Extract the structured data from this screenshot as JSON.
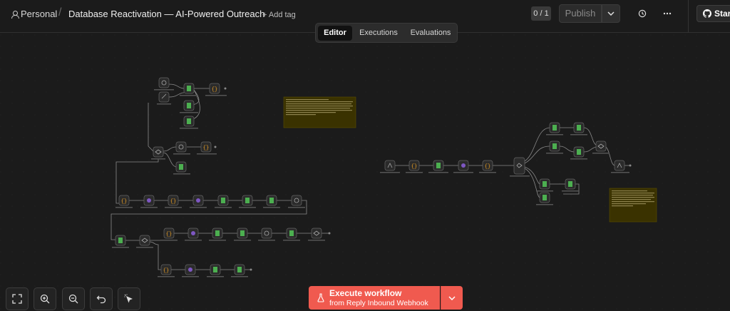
{
  "breadcrumb": {
    "project": "Personal",
    "separator": "/",
    "workflow_name": "Database Reactivation — AI-Powered Outreach",
    "add_tag": "+ Add tag"
  },
  "header": {
    "counter": "0 / 1",
    "publish_label": "Publish",
    "star_label": "Star"
  },
  "tabs": [
    {
      "label": "Editor",
      "active": true
    },
    {
      "label": "Executions",
      "active": false
    },
    {
      "label": "Evaluations",
      "active": false
    }
  ],
  "execute": {
    "label": "Execute workflow",
    "sublabel": "from Reply Inbound Webhook"
  },
  "icons": {
    "history": "history-icon",
    "more": "more-horizontal-icon",
    "github": "github-icon",
    "fit": "fit-view-icon",
    "zoom_in": "zoom-in-icon",
    "zoom_out": "zoom-out-icon",
    "undo": "undo-icon",
    "tidy": "tidy-up-icon",
    "flask": "flask-icon"
  },
  "colors": {
    "background": "#1b1b1b",
    "execute": "#f05a4f",
    "sticky": "#3a3200",
    "node": "#2b2b2b"
  }
}
